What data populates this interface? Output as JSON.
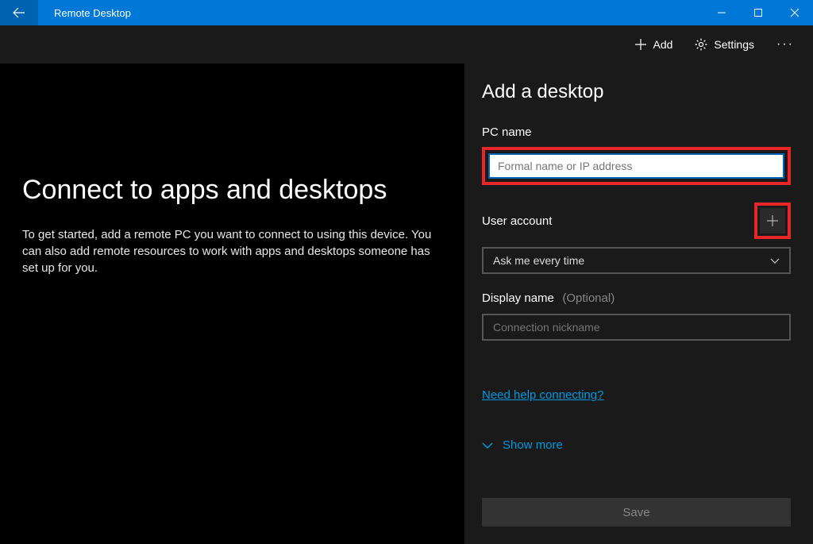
{
  "titlebar": {
    "title": "Remote Desktop"
  },
  "toolbar": {
    "add_label": "Add",
    "settings_label": "Settings"
  },
  "left": {
    "heading": "Connect to apps and desktops",
    "description": "To get started, add a remote PC you want to connect to using this device. You can also add remote resources to work with apps and desktops someone has set up for you."
  },
  "panel": {
    "title": "Add a desktop",
    "pc_name_label": "PC name",
    "pc_name_placeholder": "Formal name or IP address",
    "user_account_label": "User account",
    "user_account_selected": "Ask me every time",
    "display_name_label": "Display name",
    "display_name_optional": "(Optional)",
    "display_name_placeholder": "Connection nickname",
    "help_link": "Need help connecting?",
    "show_more": "Show more",
    "save_label": "Save"
  }
}
